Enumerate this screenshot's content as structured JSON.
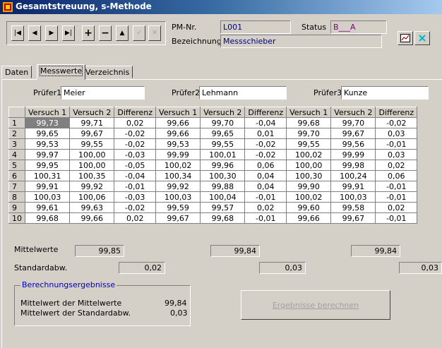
{
  "window": {
    "title": "Gesamtstreuung, s-Methode"
  },
  "header": {
    "pm_nr_label": "PM-Nr.",
    "pm_nr_value": "L001",
    "bezeichnung_label": "Bezeichnung",
    "bezeichnung_value": "Messschieber",
    "status_label": "Status",
    "status_value": "B___A"
  },
  "toolbar": {
    "first": "|◀",
    "prev": "◀",
    "next": "▶",
    "last": "▶|",
    "add": "+",
    "delete": "−",
    "up": "▲",
    "check": "✓",
    "cancel": "✕"
  },
  "tabs": [
    "Daten",
    "Messwerte",
    "Verzeichnis"
  ],
  "pruefer": [
    {
      "label": "Prüfer1",
      "value": "Meier"
    },
    {
      "label": "Prüfer2",
      "value": "Lehmann"
    },
    {
      "label": "Prüfer3",
      "value": "Kunze"
    }
  ],
  "grid": {
    "headers": [
      "Versuch 1",
      "Versuch 2",
      "Differenz",
      "Versuch 1",
      "Versuch 2",
      "Differenz",
      "Versuch 1",
      "Versuch 2",
      "Differenz"
    ],
    "rows": [
      [
        "1",
        "99,73",
        "99,71",
        "0,02",
        "99,66",
        "99,70",
        "-0,04",
        "99,68",
        "99,70",
        "-0,02"
      ],
      [
        "2",
        "99,65",
        "99,67",
        "-0,02",
        "99,66",
        "99,65",
        "0,01",
        "99,70",
        "99,67",
        "0,03"
      ],
      [
        "3",
        "99,53",
        "99,55",
        "-0,02",
        "99,53",
        "99,55",
        "-0,02",
        "99,55",
        "99,56",
        "-0,01"
      ],
      [
        "4",
        "99,97",
        "100,00",
        "-0,03",
        "99,99",
        "100,01",
        "-0,02",
        "100,02",
        "99,99",
        "0,03"
      ],
      [
        "5",
        "99,95",
        "100,00",
        "-0,05",
        "100,02",
        "99,96",
        "0,06",
        "100,00",
        "99,98",
        "0,02"
      ],
      [
        "6",
        "100,31",
        "100,35",
        "-0,04",
        "100,34",
        "100,30",
        "0,04",
        "100,30",
        "100,24",
        "0,06"
      ],
      [
        "7",
        "99,91",
        "99,92",
        "-0,01",
        "99,92",
        "99,88",
        "0,04",
        "99,90",
        "99,91",
        "-0,01"
      ],
      [
        "8",
        "100,03",
        "100,06",
        "-0,03",
        "100,03",
        "100,04",
        "-0,01",
        "100,02",
        "100,03",
        "-0,01"
      ],
      [
        "9",
        "99,61",
        "99,63",
        "-0,02",
        "99,59",
        "99,57",
        "0,02",
        "99,60",
        "99,58",
        "0,02"
      ],
      [
        "10",
        "99,68",
        "99,66",
        "0,02",
        "99,67",
        "99,68",
        "-0,01",
        "99,66",
        "99,67",
        "-0,01"
      ]
    ]
  },
  "summary": {
    "mittelwerte_label": "Mittelwerte",
    "mittelwerte": [
      "99,85",
      "99,84",
      "99,84"
    ],
    "standardabw_label": "Standardabw.",
    "standardabw": [
      "0,02",
      "0,03",
      "0,03"
    ]
  },
  "results": {
    "group_label": "Berechnungsergebnisse",
    "mw_label": "Mittelwert der Mittelwerte",
    "mw_value": "99,84",
    "sd_label": "Mittelwert der Standardabw.",
    "sd_value": "0,03",
    "button_label": "Ergebnisse berechnen"
  }
}
